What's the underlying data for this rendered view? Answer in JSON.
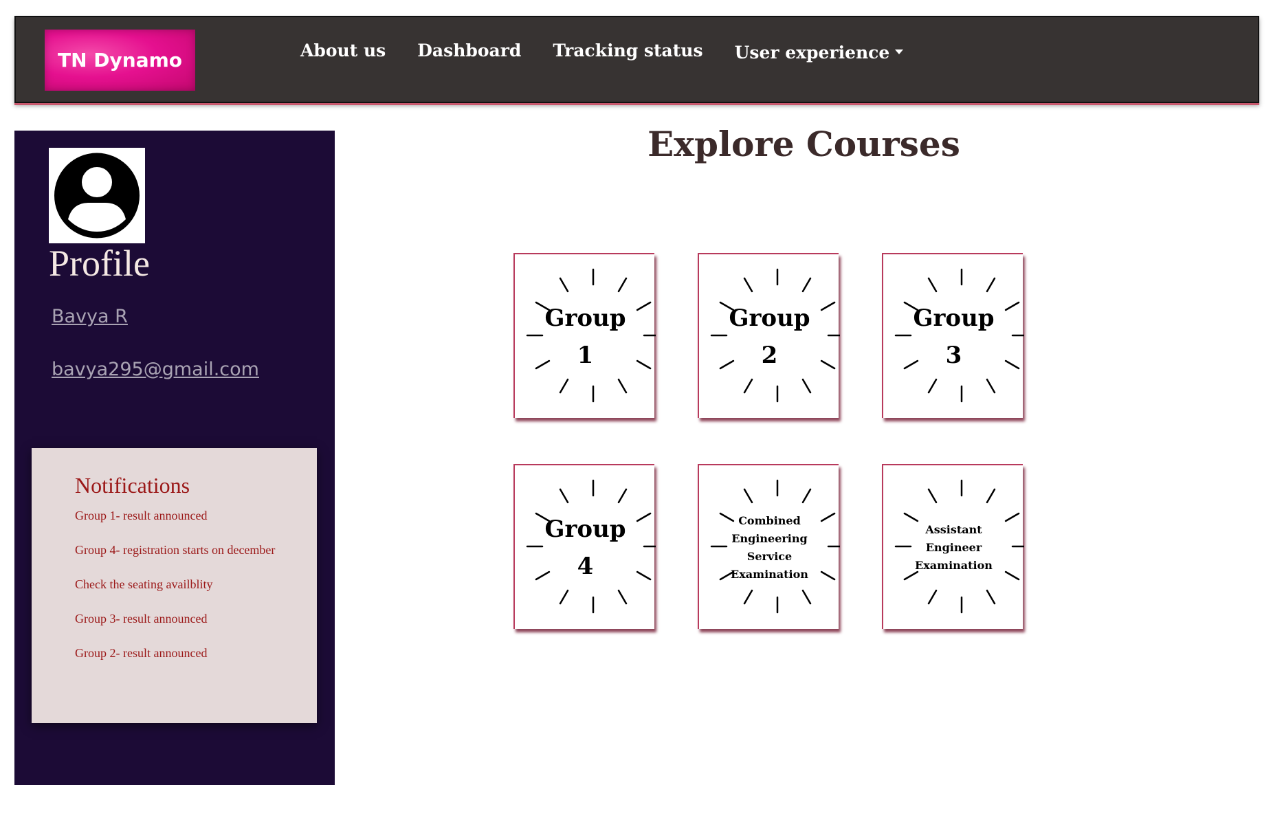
{
  "navbar": {
    "brand": "TN Dynamo",
    "links": [
      "About us",
      "Dashboard",
      "Tracking status"
    ],
    "dropdown": "User experience"
  },
  "sidebar": {
    "title": "Profile",
    "name": "Bavya R",
    "email": "bavya295@gmail.com"
  },
  "notifications": {
    "title": "Notifications",
    "items": [
      "Group 1- result announced",
      "Group 4- registration starts on december",
      "Check the seating availblity",
      "Group 3- result announced",
      "Group 2- result announced"
    ]
  },
  "main": {
    "title": "Explore Courses",
    "courses": [
      "Group 1",
      "Group 2",
      "Group 3",
      "Group 4",
      "Combined Engineering Service Examination",
      "Assistant Engineer Examination"
    ]
  }
}
